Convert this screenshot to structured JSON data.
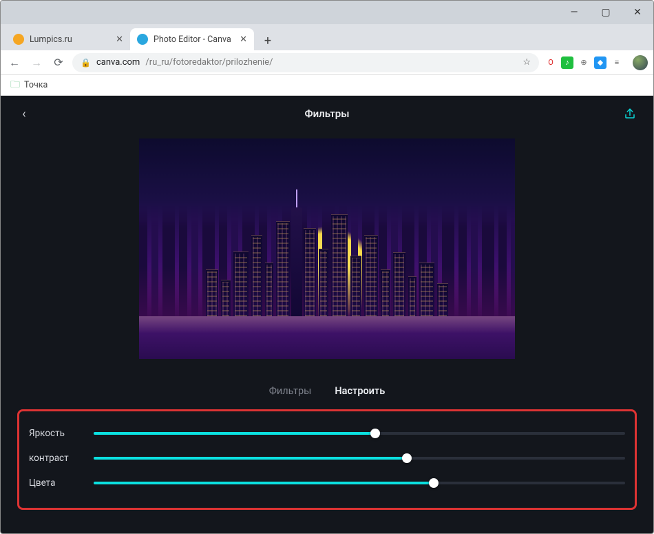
{
  "window": {
    "minimize": "—",
    "maximize": "▢",
    "close": "✕"
  },
  "tabs": [
    {
      "title": "Lumpics.ru",
      "favicon_bg": "#f5a623",
      "active": false
    },
    {
      "title": "Photo Editor - Canva",
      "favicon_bg": "#2aa7df",
      "active": true
    }
  ],
  "address": {
    "lock": "🔒",
    "host": "canva.com",
    "path": "/ru_ru/fotoredaktor/prilozhenie/",
    "star": "☆"
  },
  "extensions": [
    {
      "bg": "#ffffff",
      "fg": "#d22",
      "glyph": "O"
    },
    {
      "bg": "#1fbf3f",
      "fg": "#fff",
      "glyph": "♪"
    },
    {
      "bg": "#ffffff",
      "fg": "#666",
      "glyph": "⊕"
    },
    {
      "bg": "#2196f3",
      "fg": "#fff",
      "glyph": "◆"
    },
    {
      "bg": "#ffffff",
      "fg": "#666",
      "glyph": "≡"
    }
  ],
  "bookmarks": {
    "item1": "Точка"
  },
  "app": {
    "title": "Фильтры",
    "back": "‹",
    "tabs": {
      "filters": "Фильтры",
      "adjust": "Настроить"
    },
    "adjust": [
      {
        "label": "Яркость",
        "percent": 53
      },
      {
        "label": "контраст",
        "percent": 59
      },
      {
        "label": "Цвета",
        "percent": 64
      }
    ]
  }
}
